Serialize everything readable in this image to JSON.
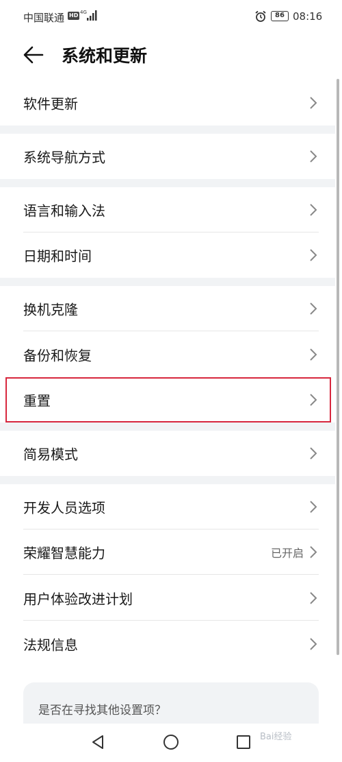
{
  "status_bar": {
    "carrier": "中国联通",
    "hd": "HD",
    "network": "4G",
    "battery": "86",
    "time": "08:16"
  },
  "header": {
    "title": "系统和更新"
  },
  "groups": [
    {
      "items": [
        {
          "label": "软件更新"
        }
      ]
    },
    {
      "items": [
        {
          "label": "系统导航方式"
        }
      ]
    },
    {
      "items": [
        {
          "label": "语言和输入法"
        },
        {
          "label": "日期和时间"
        }
      ]
    },
    {
      "items": [
        {
          "label": "换机克隆"
        },
        {
          "label": "备份和恢复"
        },
        {
          "label": "重置",
          "highlighted": true
        }
      ]
    },
    {
      "items": [
        {
          "label": "简易模式"
        }
      ]
    },
    {
      "items": [
        {
          "label": "开发人员选项"
        },
        {
          "label": "荣耀智慧能力",
          "value": "已开启"
        },
        {
          "label": "用户体验改进计划"
        },
        {
          "label": "法规信息"
        }
      ]
    }
  ],
  "suggestion": {
    "question": "是否在寻找其他设置项？"
  },
  "watermark": "Bai经验",
  "colors": {
    "highlight_border": "#d7263d",
    "group_gap": "#f1f3f5",
    "text": "#1a1a1a",
    "secondary": "#666666"
  },
  "icons": {
    "back": "arrow-left-icon",
    "chevron": "chevron-right-icon",
    "nav": [
      "back-triangle-icon",
      "home-circle-icon",
      "recents-square-icon"
    ]
  }
}
